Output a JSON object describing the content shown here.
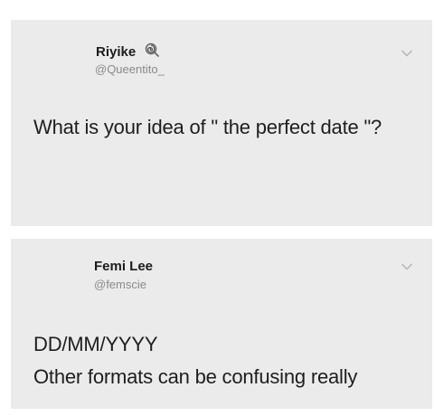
{
  "tweets": [
    {
      "display_name": "Riyike",
      "username": "@Queentito_",
      "name_emoji": "lollipop-icon",
      "text": "What is your idea of \" the perfect date \"?"
    },
    {
      "display_name": "Femi Lee",
      "username": "@femscie",
      "text_lines": [
        "DD/MM/YYYY",
        "Other formats can be confusing really"
      ]
    }
  ],
  "colors": {
    "card_background": "#ebebeb",
    "text": "#1e1e1e",
    "handle": "#8a8a8a",
    "chevron": "#b5b5b5"
  }
}
